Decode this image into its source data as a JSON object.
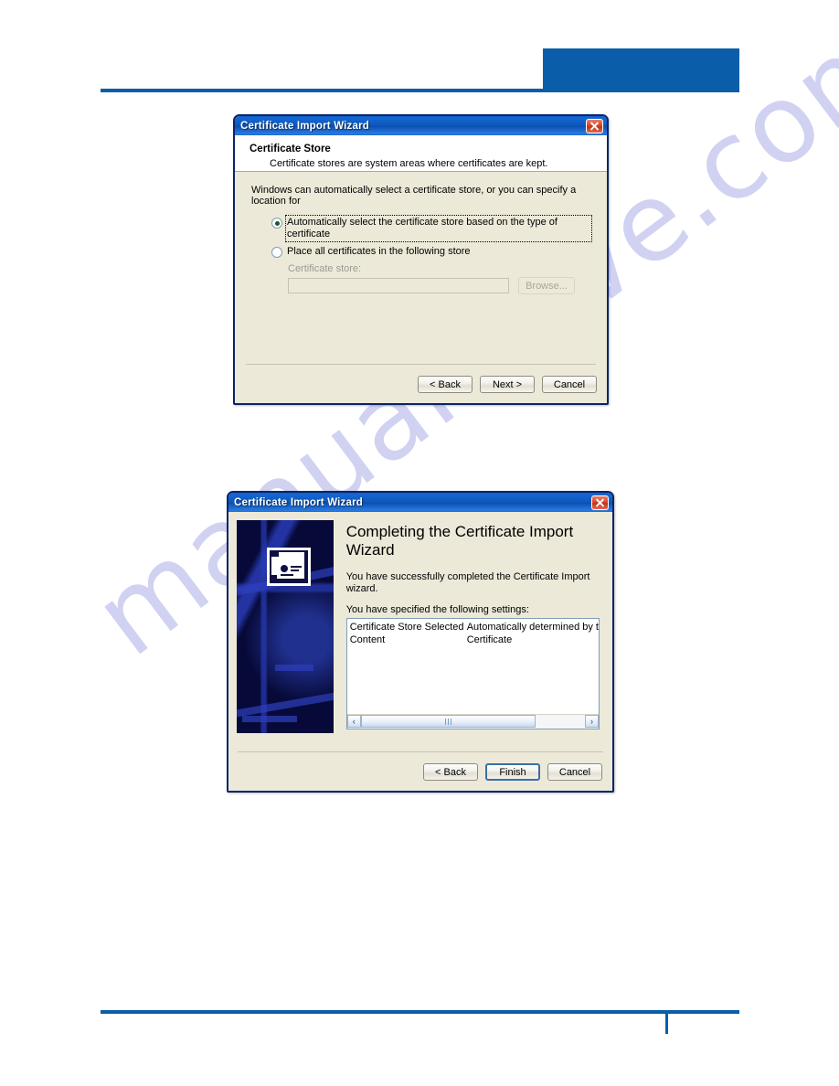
{
  "page": {
    "accent_color": "#0a5da8",
    "watermark_text": "manualshive.com"
  },
  "dialog_store": {
    "title": "Certificate Import Wizard",
    "close_icon": "close-icon",
    "header": {
      "title": "Certificate Store",
      "subtitle": "Certificate stores are system areas where certificates are kept."
    },
    "intro": "Windows can automatically select a certificate store, or you can specify a location for",
    "options": [
      {
        "label": "Automatically select the certificate store based on the type of certificate",
        "selected": true
      },
      {
        "label": "Place all certificates in the following store",
        "selected": false
      }
    ],
    "store_field": {
      "label": "Certificate store:",
      "value": "",
      "browse_label": "Browse..."
    },
    "buttons": {
      "back": "< Back",
      "next": "Next >",
      "cancel": "Cancel"
    }
  },
  "dialog_finish": {
    "title": "Certificate Import Wizard",
    "close_icon": "close-icon",
    "banner_icon": "certificate-icon",
    "heading": "Completing the Certificate Import Wizard",
    "paragraph": "You have successfully completed the Certificate Import wizard.",
    "settings_label": "You have specified the following settings:",
    "settings": [
      {
        "key": "Certificate Store Selected",
        "value": "Automatically determined by t"
      },
      {
        "key": "Content",
        "value": "Certificate"
      }
    ],
    "scroll": {
      "left_arrow": "‹",
      "right_arrow": "›"
    },
    "buttons": {
      "back": "< Back",
      "finish": "Finish",
      "cancel": "Cancel"
    }
  }
}
